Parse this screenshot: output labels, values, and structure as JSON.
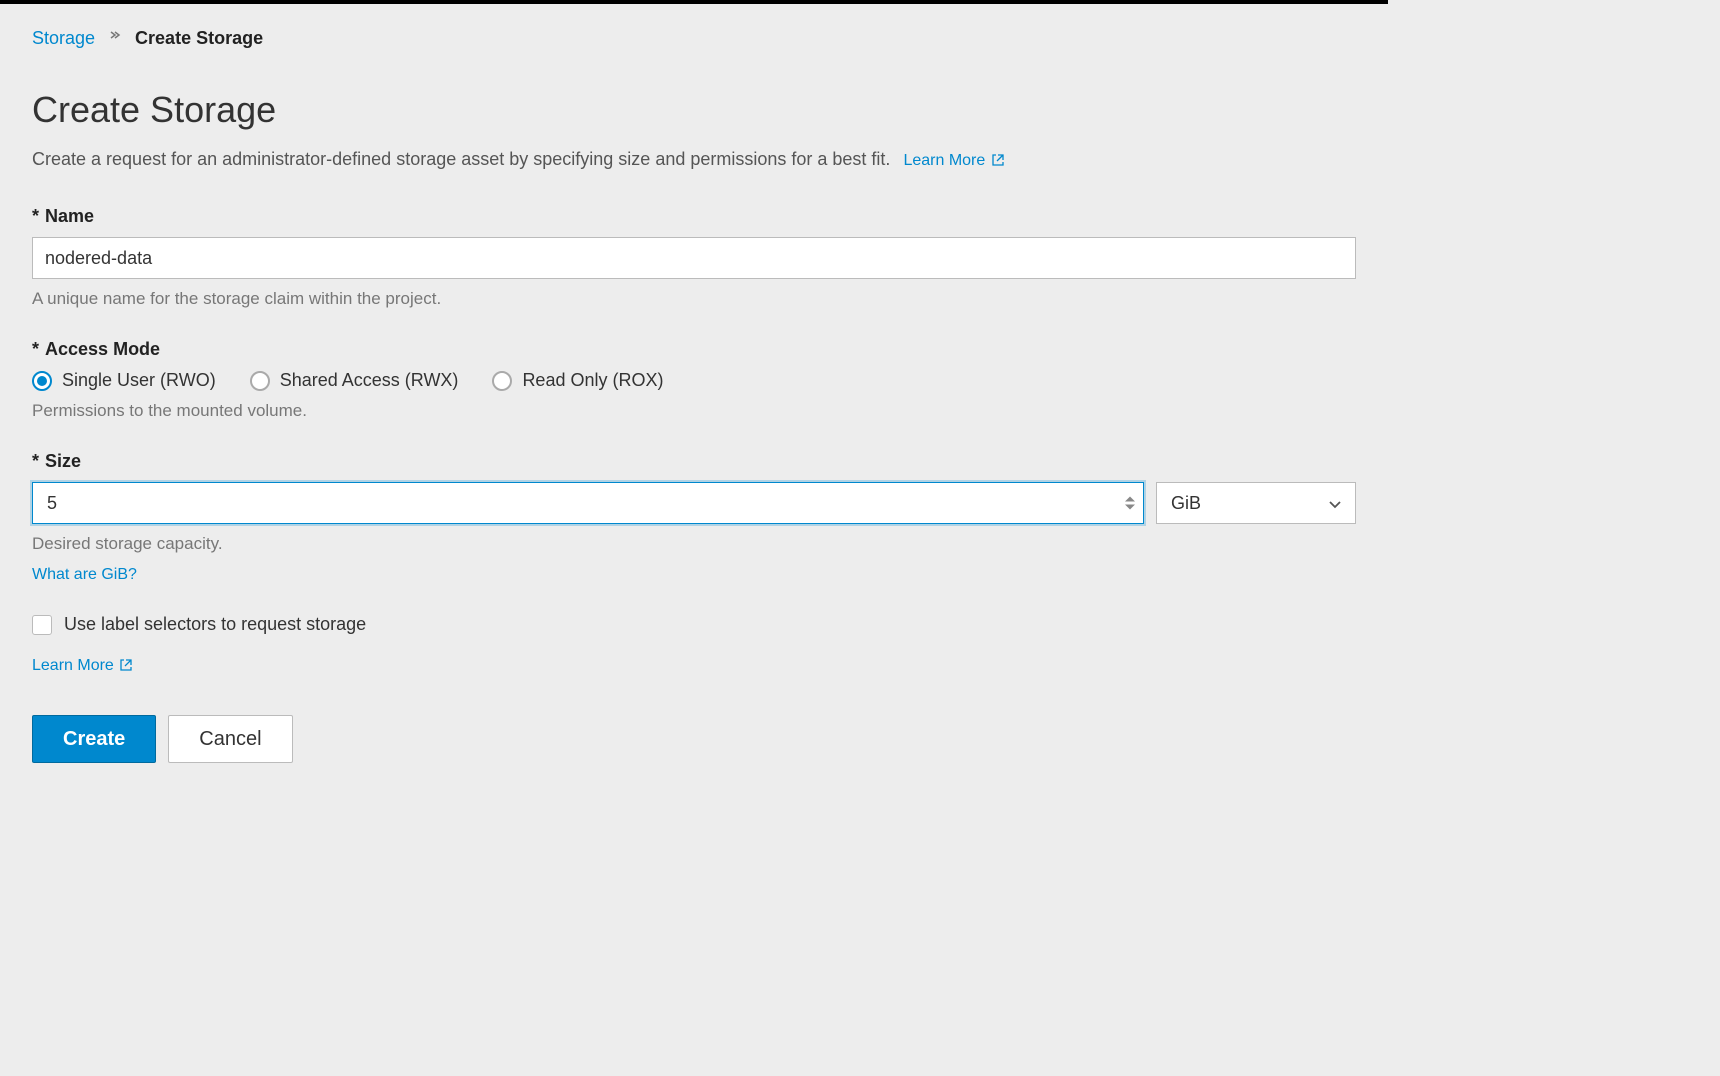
{
  "breadcrumb": {
    "parent": "Storage",
    "current": "Create Storage"
  },
  "header": {
    "title": "Create Storage",
    "subtitle": "Create a request for an administrator-defined storage asset by specifying size and permissions for a best fit.",
    "learn_more": "Learn More"
  },
  "form": {
    "name": {
      "label": "Name",
      "value": "nodered-data",
      "help": "A unique name for the storage claim within the project."
    },
    "access_mode": {
      "label": "Access Mode",
      "options": [
        {
          "label": "Single User (RWO)",
          "selected": true
        },
        {
          "label": "Shared Access (RWX)",
          "selected": false
        },
        {
          "label": "Read Only (ROX)",
          "selected": false
        }
      ],
      "help": "Permissions to the mounted volume."
    },
    "size": {
      "label": "Size",
      "value": "5",
      "unit": "GiB",
      "help": "Desired storage capacity.",
      "what_link": "What are GiB?"
    },
    "use_labels": {
      "label": "Use label selectors to request storage",
      "checked": false,
      "learn_more": "Learn More"
    }
  },
  "buttons": {
    "create": "Create",
    "cancel": "Cancel"
  }
}
